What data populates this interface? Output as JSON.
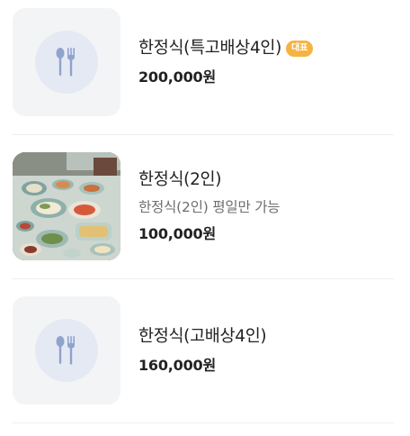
{
  "menu_items": [
    {
      "name": "한정식(특고배상4인)",
      "badge": "대표",
      "price": "200,000원",
      "image": "placeholder",
      "icon": "utensils-icon"
    },
    {
      "name": "한정식(2인)",
      "description": "한정식(2인) 평일만 가능",
      "price": "100,000원",
      "image": "korean-table-dishes-photo"
    },
    {
      "name": "한정식(고배상4인)",
      "price": "160,000원",
      "image": "placeholder",
      "icon": "utensils-icon"
    }
  ],
  "colors": {
    "badge": "#f5b343",
    "placeholder_bg": "#f3f4f6",
    "placeholder_circle": "#e4e9f3",
    "icon": "#8fa3cf",
    "text": "#222222",
    "description": "#6e6e6e",
    "divider": "#eeeeee"
  }
}
